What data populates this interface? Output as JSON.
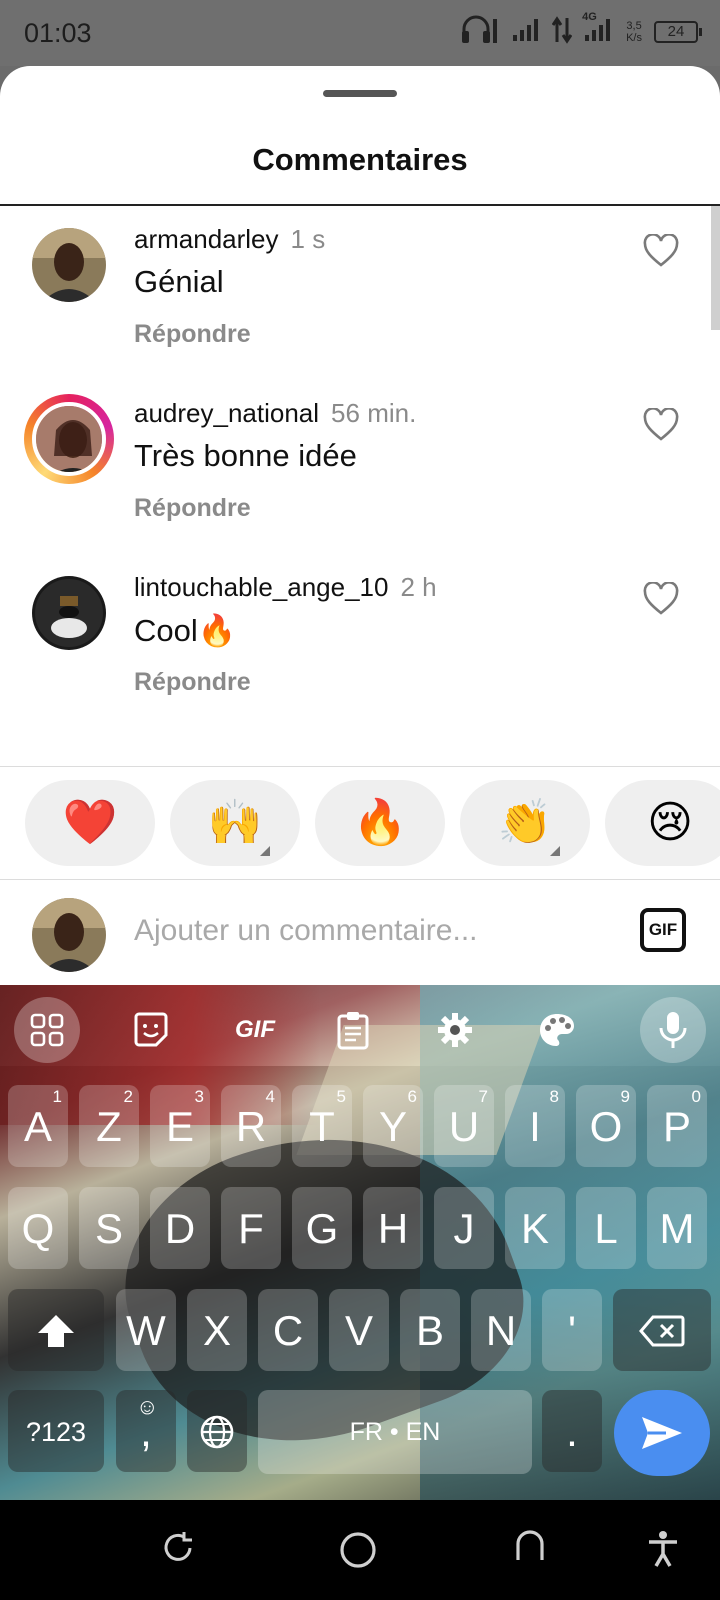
{
  "status_bar": {
    "time": "01:03",
    "network": "4G",
    "speed_value": "3,5",
    "speed_unit": "K/s",
    "battery": "24"
  },
  "sheet": {
    "title": "Commentaires"
  },
  "comments": [
    {
      "username": "armandarley",
      "time": "1 s",
      "text": "Génial",
      "reply": "Répondre"
    },
    {
      "username": "audrey_national",
      "time": "56 min.",
      "text": "Très bonne idée",
      "reply": "Répondre"
    },
    {
      "username": "lintouchable_ange_10",
      "time": "2 h",
      "text": "Cool🔥",
      "reply": "Répondre"
    }
  ],
  "reactions": [
    "❤️",
    "🙌",
    "🔥",
    "👏",
    "😢"
  ],
  "composer": {
    "placeholder": "Ajouter un commentaire...",
    "gif_label": "GIF"
  },
  "keyboard": {
    "toolbar_gif": "GIF",
    "row1": [
      "A",
      "Z",
      "E",
      "R",
      "T",
      "Y",
      "U",
      "I",
      "O",
      "P"
    ],
    "row1_hints": [
      "1",
      "2",
      "3",
      "4",
      "5",
      "6",
      "7",
      "8",
      "9",
      "0"
    ],
    "row2": [
      "Q",
      "S",
      "D",
      "F",
      "G",
      "H",
      "J",
      "K",
      "L",
      "M"
    ],
    "row3": [
      "W",
      "X",
      "C",
      "V",
      "B",
      "N",
      "'"
    ],
    "symbols_label": "?123",
    "comma": ",",
    "period": ".",
    "space_label": "FR • EN"
  },
  "colors": {
    "accent_blue": "#4a8ef0",
    "story_ring": "#d6249f",
    "muted_text": "#8a8a8a"
  }
}
